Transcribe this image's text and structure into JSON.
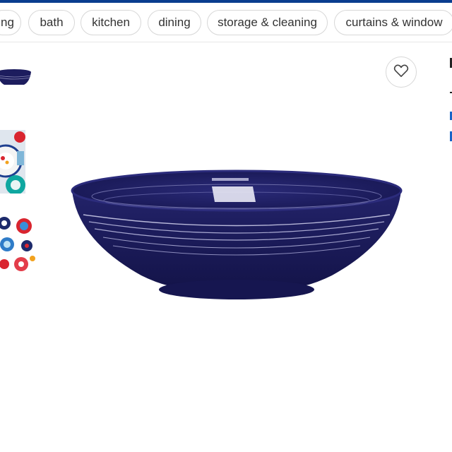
{
  "categories": [
    {
      "label": "ng"
    },
    {
      "label": "bath"
    },
    {
      "label": "kitchen"
    },
    {
      "label": "dining"
    },
    {
      "label": "storage & cleaning"
    },
    {
      "label": "curtains & window"
    }
  ],
  "colors": {
    "brand_stripe": "#0a3d8f",
    "bowl": "#1d1d5e",
    "link": "#1763c7"
  },
  "product": {
    "thumbnails": [
      {
        "icon": "bowl-thumbnail"
      },
      {
        "icon": "table-setting-thumbnail"
      },
      {
        "icon": "colorful-dishes-thumbnail"
      }
    ],
    "main_image_icon": "navy-bowl-image",
    "favorite_icon": "heart-icon"
  }
}
